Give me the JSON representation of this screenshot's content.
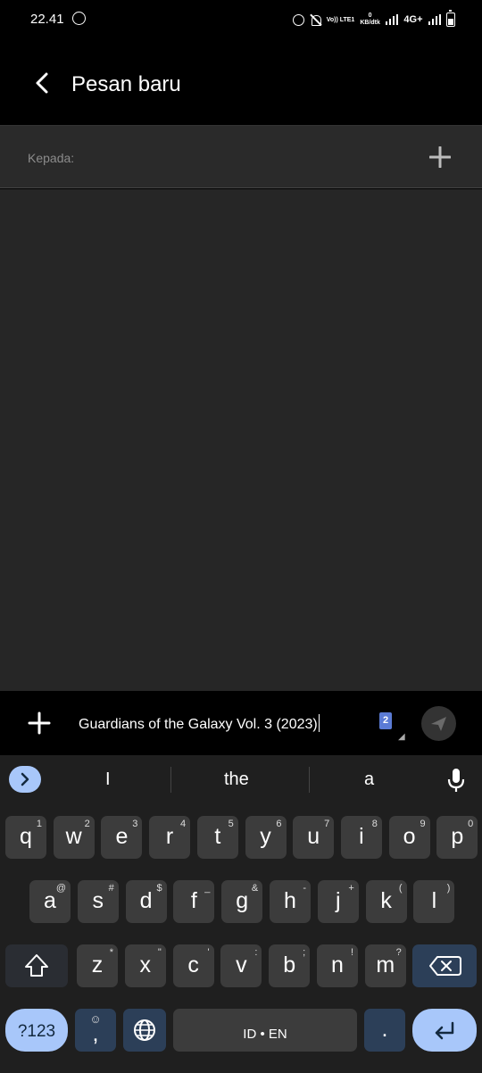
{
  "status_bar": {
    "time": "22.41",
    "volte_label": "Vo)) LTE1",
    "net_speed_value": "0",
    "net_speed_unit": "KB/dtk",
    "network_type": "4G+"
  },
  "app_bar": {
    "title": "Pesan baru",
    "back_icon": "chevron-left-icon"
  },
  "recipient": {
    "label": "Kepada:",
    "add_icon": "plus-icon"
  },
  "compose": {
    "attach_icon": "plus-icon",
    "message_text": "Guardians of the Galaxy Vol. 3 (2023)",
    "sim_badge": "2",
    "send_icon": "send-icon"
  },
  "keyboard": {
    "suggestions": [
      "I",
      "the",
      "a"
    ],
    "row1": [
      {
        "key": "q",
        "hint": "1"
      },
      {
        "key": "w",
        "hint": "2"
      },
      {
        "key": "e",
        "hint": "3"
      },
      {
        "key": "r",
        "hint": "4"
      },
      {
        "key": "t",
        "hint": "5"
      },
      {
        "key": "y",
        "hint": "6"
      },
      {
        "key": "u",
        "hint": "7"
      },
      {
        "key": "i",
        "hint": "8"
      },
      {
        "key": "o",
        "hint": "9"
      },
      {
        "key": "p",
        "hint": "0"
      }
    ],
    "row2": [
      {
        "key": "a",
        "hint": "@"
      },
      {
        "key": "s",
        "hint": "#"
      },
      {
        "key": "d",
        "hint": "$"
      },
      {
        "key": "f",
        "hint": "_"
      },
      {
        "key": "g",
        "hint": "&"
      },
      {
        "key": "h",
        "hint": "-"
      },
      {
        "key": "j",
        "hint": "+"
      },
      {
        "key": "k",
        "hint": "("
      },
      {
        "key": "l",
        "hint": ")"
      }
    ],
    "row3": [
      {
        "key": "z",
        "hint": "*"
      },
      {
        "key": "x",
        "hint": "\""
      },
      {
        "key": "c",
        "hint": "'"
      },
      {
        "key": "v",
        "hint": ":"
      },
      {
        "key": "b",
        "hint": ";"
      },
      {
        "key": "n",
        "hint": "!"
      },
      {
        "key": "m",
        "hint": "?"
      }
    ],
    "symbols_label": "?123",
    "comma_label": ",",
    "emoji_hint": "☺",
    "space_label": "ID • EN",
    "period_label": "."
  },
  "colors": {
    "accent": "#a8c7fa",
    "key_bg": "#3c3c3c",
    "keyboard_bg": "#1f1f1f",
    "sim_badge": "#5b7bd5"
  }
}
